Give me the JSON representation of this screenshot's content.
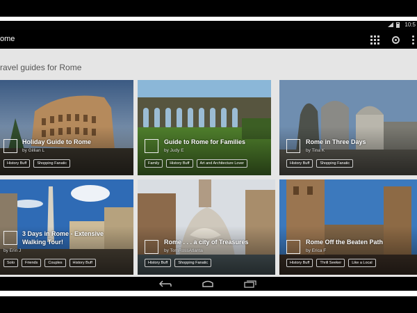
{
  "status_bar": {
    "time": "10:5"
  },
  "action_bar": {
    "title": "ome",
    "icons": [
      "grid-view-icon",
      "settings-target-icon",
      "overflow-menu-icon"
    ]
  },
  "content": {
    "section_title": "ravel guides for Rome"
  },
  "guides": [
    {
      "title": "Holiday Guide to Rome",
      "author": "by Gillian L",
      "tags": [
        "History Buff",
        "Shopping Fanatic"
      ]
    },
    {
      "title": "Guide to Rome for Families",
      "author": "by Judy E",
      "tags": [
        "Family",
        "History Buff",
        "Art and Architecture Lover"
      ]
    },
    {
      "title": "Rome in Three Days",
      "author": "by Tina K",
      "tags": [
        "History Buff",
        "Shopping Fanatic"
      ]
    },
    {
      "title": "3 Days in Rome - Extensive Walking Tour!",
      "author": "by Erin J",
      "tags": [
        "Solo",
        "Friends",
        "Couples",
        "History Buff"
      ]
    },
    {
      "title": "Rome . . . a city of Treasures",
      "author": "by TomRossAtlanta",
      "tags": [
        "History Buff",
        "Shopping Fanatic"
      ]
    },
    {
      "title": "Rome Off the Beaten Path",
      "author": "by Erica F",
      "tags": [
        "History Buff",
        "Thrill Seeker",
        "Like a Local"
      ]
    }
  ],
  "nav_bar": {
    "icons": [
      "back-icon",
      "home-icon",
      "recent-apps-icon"
    ]
  },
  "colors": {
    "content_bg": "#e5e5e5",
    "bar_bg": "#000000"
  }
}
